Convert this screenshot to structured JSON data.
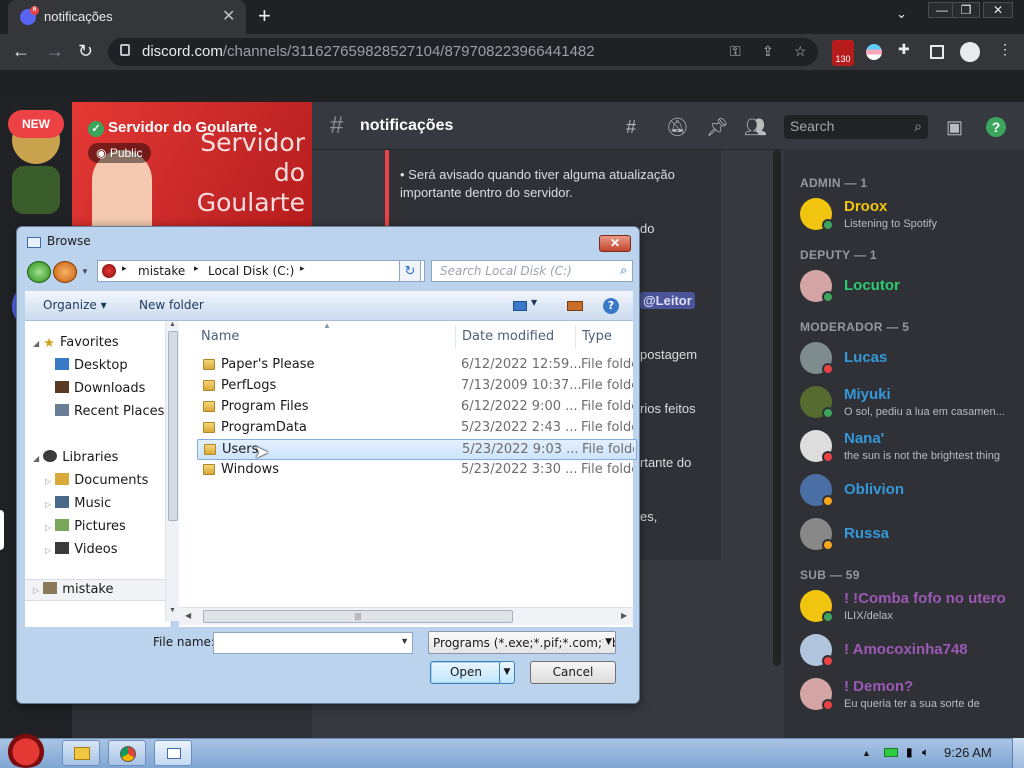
{
  "browser": {
    "tab_title": "notificações",
    "tab_badge": "6",
    "url_domain": "discord.com",
    "url_path": "/channels/311627659828527104/879708223966441482",
    "ext_badge": "130"
  },
  "discord": {
    "new_badge": "NEW",
    "server_name": "Servidor do Goularte",
    "public_label": "Public",
    "banner_text": "Servidor do Goularte",
    "channel_name": "notificações",
    "search_placeholder": "Search",
    "messages": [
      "• Será avisado quando tiver alguma atualização",
      "importante dentro do servidor.",
      "do",
      "postagem",
      "rios feitos",
      "rtante do",
      "es,"
    ],
    "mention": "@Leitor",
    "members": [
      {
        "category": "ADMIN — 1"
      },
      {
        "name": "Droox",
        "sub": "Listening to Spotify",
        "color": "#f1c40f",
        "status": "#3ba55d"
      },
      {
        "category": "DEPUTY — 1"
      },
      {
        "name": "Locutor",
        "color": "#2ecc71",
        "status": "#3ba55d"
      },
      {
        "category": "MODERADOR — 5"
      },
      {
        "name": "Lucas",
        "color": "#3498db",
        "status": "#ed4245"
      },
      {
        "name": "Miyuki",
        "sub": "O sol, pediu a lua em casamen...",
        "color": "#3498db",
        "status": "#3ba55d"
      },
      {
        "name": "Nana'",
        "sub": "the sun is not the brightest thing",
        "color": "#3498db",
        "status": "#ed4245"
      },
      {
        "name": "Oblivion",
        "color": "#3498db",
        "status": "#faa61a"
      },
      {
        "name": "Russa",
        "color": "#3498db",
        "status": "#faa61a"
      },
      {
        "category": "SUB — 59"
      },
      {
        "name": "! !Comba fofo no utero",
        "sub": "ILIX/delax",
        "color": "#9b59b6",
        "status": "#3ba55d"
      },
      {
        "name": "! Amocoxinha748",
        "color": "#9b59b6",
        "status": "#ed4245"
      },
      {
        "name": "! Demon?",
        "sub": "Eu queria ter a sua sorte de",
        "color": "#9b59b6",
        "status": "#ed4245"
      }
    ]
  },
  "dialog": {
    "title": "Browse",
    "close": "✕",
    "address": [
      "mistake",
      "Local Disk (C:)"
    ],
    "search_placeholder": "Search Local Disk (C:)",
    "organize": "Organize ▾",
    "new_folder": "New folder",
    "nav": {
      "favorites": "Favorites",
      "desktop": "Desktop",
      "downloads": "Downloads",
      "recent": "Recent Places",
      "libraries": "Libraries",
      "documents": "Documents",
      "music": "Music",
      "pictures": "Pictures",
      "videos": "Videos",
      "mistake": "mistake"
    },
    "columns": {
      "name": "Name",
      "date": "Date modified",
      "type": "Type"
    },
    "files": [
      {
        "name": "Paper's Please",
        "date": "6/12/2022 12:59...",
        "type": "File folder"
      },
      {
        "name": "PerfLogs",
        "date": "7/13/2009 10:37...",
        "type": "File folder"
      },
      {
        "name": "Program Files",
        "date": "6/12/2022 9:00 ...",
        "type": "File folder"
      },
      {
        "name": "ProgramData",
        "date": "5/23/2022 2:43 ...",
        "type": "File folder"
      },
      {
        "name": "Users",
        "date": "5/23/2022 9:03 ...",
        "type": "File folder"
      },
      {
        "name": "Windows",
        "date": "5/23/2022 3:30 ...",
        "type": "File folder"
      }
    ],
    "selected_index": 4,
    "file_name_label": "File name:",
    "file_name_value": "",
    "file_type": "Programs (*.exe;*.pif;*.com;*.bat",
    "open": "Open",
    "cancel": "Cancel",
    "hscroll_grip": "|||"
  },
  "taskbar": {
    "clock": "9:26 AM"
  }
}
